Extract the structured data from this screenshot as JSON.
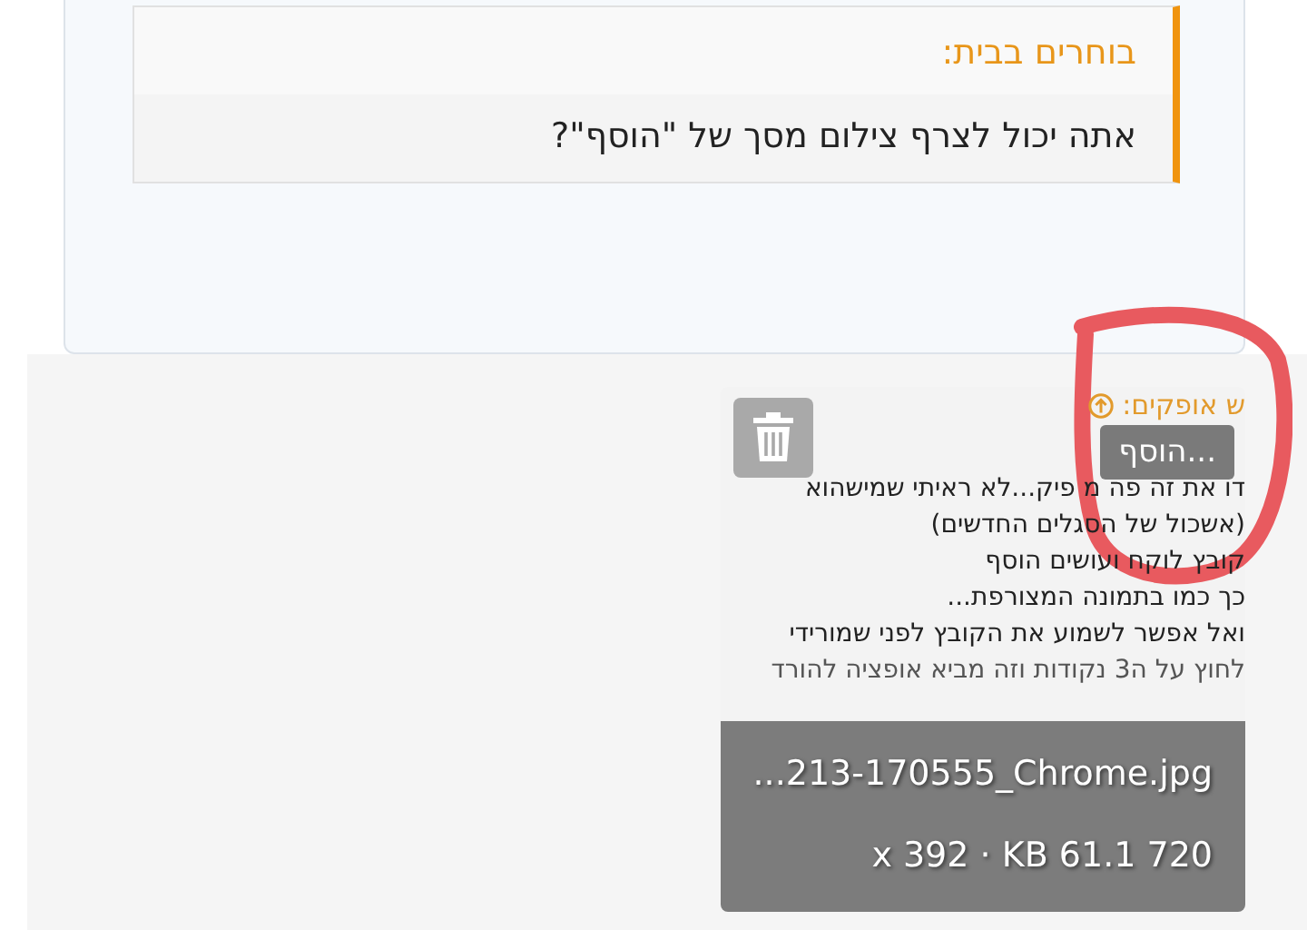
{
  "quote": {
    "author": "בוחרים בבית:",
    "text": "אתה יכול לצרף צילום מסך של \"הוסף\"?"
  },
  "attachment": {
    "shot": {
      "author": "ש אופקים:",
      "lines": [
        "דו את זה פה מ פיק...לא ראיתי שמישהוא",
        "(אשכול של הסגלים החדשים)",
        "קובץ לוקח ועושים הוסף",
        "כך כמו בתמונה המצורפת...",
        "ואל אפשר לשמוע את הקובץ לפני שמורידי",
        "לחוץ על ה3 נקודות וזה מביא אופציה להורד"
      ],
      "more_button": "הוסף..."
    },
    "filename": "...213-170555_Chrome.jpg",
    "info": "x 392 · KB 61.1 720"
  }
}
